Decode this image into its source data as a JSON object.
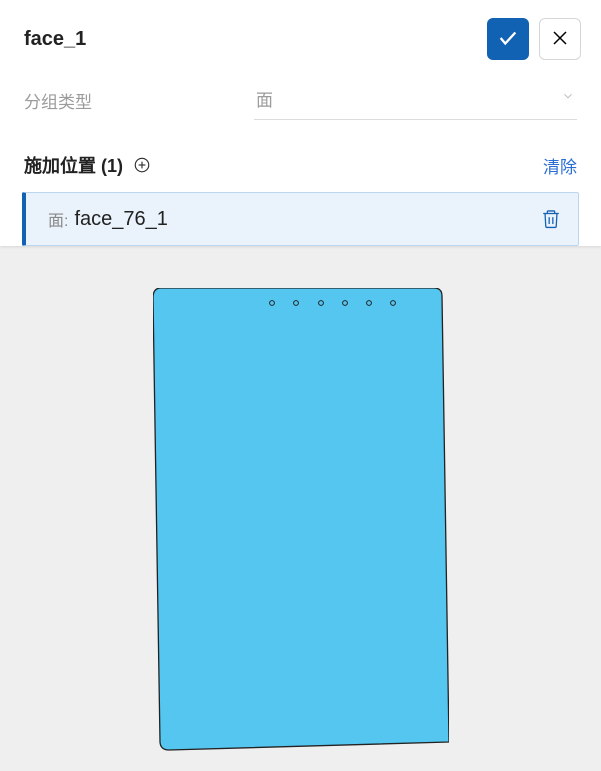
{
  "header": {
    "title": "face_1"
  },
  "group": {
    "label": "分组类型",
    "value": "面"
  },
  "location": {
    "title_prefix": "施加位置",
    "count": "(1)",
    "clear_label": "清除",
    "item": {
      "type_label": "面:",
      "name": "face_76_1"
    }
  }
}
